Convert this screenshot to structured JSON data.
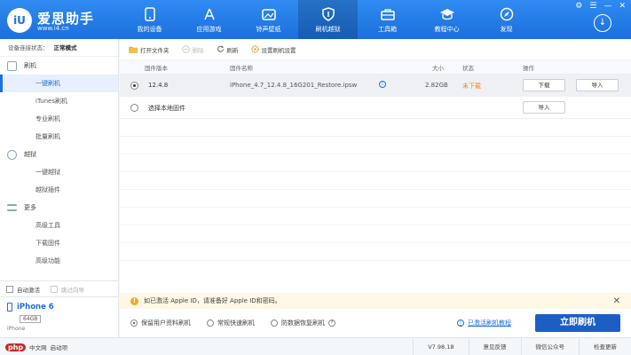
{
  "app": {
    "logo_badge": "iU",
    "name": "爱思助手",
    "url": "www.i4.cn"
  },
  "nav": [
    {
      "label": "我的设备",
      "icon": "tablet-icon"
    },
    {
      "label": "应用游戏",
      "icon": "app-store-icon"
    },
    {
      "label": "铃声壁纸",
      "icon": "image-icon"
    },
    {
      "label": "刷机越狱",
      "icon": "shield-icon"
    },
    {
      "label": "工具箱",
      "icon": "toolbox-icon"
    },
    {
      "label": "教程中心",
      "icon": "graduation-cap-icon"
    },
    {
      "label": "发现",
      "icon": "compass-icon"
    }
  ],
  "window_controls": {
    "settings": "⚙",
    "menu": "☰",
    "minimize": "—",
    "close": "✕"
  },
  "sidebar": {
    "status_label": "设备连接状态：",
    "status_value": "正常模式",
    "groups": [
      {
        "label": "刷机",
        "items": [
          "一键刷机",
          "iTunes刷机",
          "专业刷机",
          "批量刷机"
        ]
      },
      {
        "label": "越狱",
        "items": [
          "一键越狱",
          "越狱插件"
        ]
      },
      {
        "label": "更多",
        "items": [
          "高级工具",
          "下载固件",
          "高级功能"
        ]
      }
    ],
    "auto_activate": "自动激活",
    "skip_guide": "跳过向导",
    "device": {
      "name": "iPhone 6",
      "capacity": "64GB",
      "model": "iPhone"
    }
  },
  "toolbar": {
    "open_folder": "打开文件夹",
    "delete": "删除",
    "refresh": "刷新",
    "settings": "设置刷机设置"
  },
  "table": {
    "headers": {
      "version": "固件版本",
      "name": "固件名称",
      "size": "大小",
      "status": "状态",
      "action": "操作"
    },
    "row": {
      "version": "12.4.8",
      "name": "iPhone_4.7_12.4.8_16G201_Restore.ipsw",
      "size": "2.82GB",
      "status": "未下载",
      "download": "下载",
      "import": "导入"
    },
    "local": {
      "label": "选择本地固件",
      "import": "导入"
    }
  },
  "notice": {
    "text": "如已激活 Apple ID，请准备好 Apple ID和密码。"
  },
  "options": {
    "keep_data": "保留用户资料刷机",
    "quick_flash": "常规快速刷机",
    "anti_recovery": "防数据恢复刷机",
    "help_link": "已激活刷机教程",
    "flash_button": "立即刷机"
  },
  "statusbar": {
    "left_logo": "php",
    "left_text": "中文网",
    "left_suffix": "启动项",
    "version": "V7.98.18",
    "feedback": "意见反馈",
    "wechat": "微信公众号",
    "check_update": "检查更新"
  },
  "colors": {
    "accent": "#1c6fdd",
    "warning": "#f5a623",
    "status_orange": "#e8890c"
  }
}
